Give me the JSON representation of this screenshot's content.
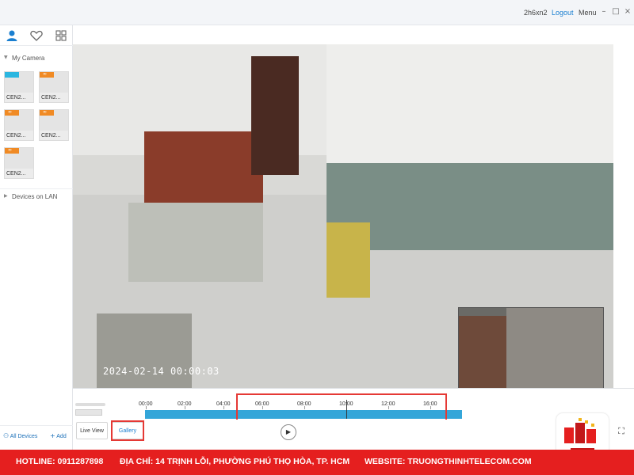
{
  "titlebar": {
    "username": "2h6xn2",
    "logout_label": "Logout",
    "menu_label": "Menu",
    "minimize_glyph": "–",
    "maximize_glyph": "□",
    "close_glyph": "×"
  },
  "sidebar": {
    "tabs": [
      {
        "name": "devices",
        "icon": "person-icon",
        "active": true
      },
      {
        "name": "favorites",
        "icon": "heart-icon",
        "active": false
      },
      {
        "name": "grid",
        "icon": "grid-icon",
        "active": false
      }
    ],
    "my_camera_label": "My Camera",
    "cameras": [
      {
        "label": "CEN2...",
        "flag_color": "#2bb6e0"
      },
      {
        "label": "CEN2...",
        "flag_color": "#f08a24"
      },
      {
        "label": "CEN2...",
        "flag_color": "#f08a24"
      },
      {
        "label": "CEN2...",
        "flag_color": "#f08a24"
      },
      {
        "label": "CEN2...",
        "flag_color": "#f08a24"
      }
    ],
    "lan_label": "Devices on LAN",
    "all_devices_label": "All Devices",
    "add_label": "Add"
  },
  "video": {
    "timestamp": "2024-02-14  00:00:03"
  },
  "timeline": {
    "ticks": [
      "00:00",
      "02:00",
      "04:00",
      "06:00",
      "08:00",
      "10:00",
      "12:00",
      "16:00"
    ],
    "recorded_until": "16:00"
  },
  "controls": {
    "live_view_label": "Live View",
    "gallery_label": "Gallery",
    "play_glyph": "▶",
    "fullscreen_glyph": "⛶"
  },
  "banner": {
    "hotline": "HOTLINE: 0911287898",
    "address": "ĐỊA CHỈ: 14 TRỊNH LỖI, PHƯỜNG PHÚ THỌ HÒA, TP. HCM",
    "website": "WEBSITE: TRUONGTHINHTELECOM.COM"
  },
  "colors": {
    "accent": "#1a7fd0",
    "timeline_bar": "#34a6d9",
    "highlight": "#e53935",
    "banner": "#e51f1f"
  }
}
